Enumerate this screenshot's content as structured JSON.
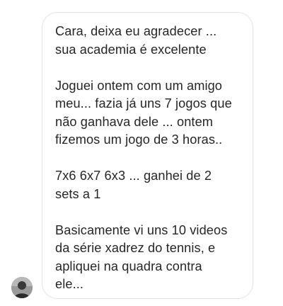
{
  "message": {
    "paragraphs": [
      "Cara, deixa eu agradecer ...\nsua academia é excelente",
      "Joguei ontem com um amigo\nmeu... fazia já uns 7 jogos que\nnão ganhava dele ... ontem\nfizemos um jogo de 3 horas..",
      "7x6 6x7 6x3 ... ganhei de 2\nsets a 1",
      "Basicamente vi uns 10 videos\nda série xadrez do tennis, e\napliquei na quadra contra\nele..."
    ]
  },
  "sender": {
    "avatar_icon": "profile-photo"
  },
  "colors": {
    "text": "#262626",
    "bubble_border": "#e3e3e3",
    "background": "#ffffff"
  }
}
